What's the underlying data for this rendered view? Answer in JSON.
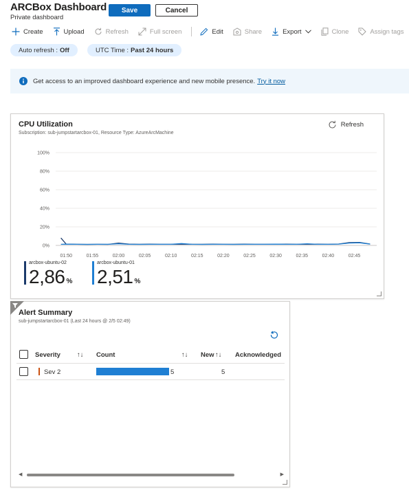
{
  "header": {
    "title": "ARCBox Dashboard",
    "subtitle": "Private dashboard"
  },
  "actions": {
    "save": "Save",
    "cancel": "Cancel"
  },
  "toolbar": {
    "create": "Create",
    "upload": "Upload",
    "refresh": "Refresh",
    "fullscreen": "Full screen",
    "edit": "Edit",
    "share": "Share",
    "export": "Export",
    "clone": "Clone",
    "assign_tags": "Assign tags"
  },
  "filters": {
    "auto_refresh_label": "Auto refresh :",
    "auto_refresh_value": "Off",
    "time_label": "UTC Time :",
    "time_value": "Past 24 hours"
  },
  "banner": {
    "text": "Get access to an improved dashboard experience and new mobile presence.",
    "link": "Try it now"
  },
  "cpu_tile": {
    "title": "CPU Utilization",
    "subtitle": "Subscription: sub-jumpstartarcbox-01, Resource Type: AzureArcMachine",
    "refresh": "Refresh",
    "kpis": [
      {
        "name": "arcbox-ubuntu-02",
        "value": "2,86",
        "unit": "%",
        "color": "#1b3a6b"
      },
      {
        "name": "arcbox-ubuntu-01",
        "value": "2,51",
        "unit": "%",
        "color": "#1f7fd3"
      }
    ]
  },
  "chart_data": {
    "type": "line",
    "title": "CPU Utilization",
    "y_ticks": [
      "100%",
      "80%",
      "60%",
      "40%",
      "20%",
      "0%"
    ],
    "ylim": [
      0,
      100
    ],
    "x_ticks": [
      "01:50",
      "01:55",
      "02:00",
      "02:05",
      "02:10",
      "02:15",
      "02:20",
      "02:25",
      "02:30",
      "02:35",
      "02:40",
      "02:45"
    ],
    "x": [
      "01:49",
      "01:50",
      "01:52",
      "01:54",
      "01:56",
      "01:58",
      "02:00",
      "02:02",
      "02:04",
      "02:06",
      "02:08",
      "02:10",
      "02:12",
      "02:14",
      "02:16",
      "02:18",
      "02:20",
      "02:22",
      "02:24",
      "02:26",
      "02:28",
      "02:30",
      "02:32",
      "02:34",
      "02:36",
      "02:38",
      "02:40",
      "02:42",
      "02:44",
      "02:46",
      "02:48"
    ],
    "series": [
      {
        "name": "arcbox-ubuntu-02",
        "color": "#1b3a6b",
        "values": [
          8,
          1.5,
          1.2,
          1.1,
          1.2,
          1.1,
          2.5,
          1.3,
          1.2,
          1.3,
          1.2,
          1.2,
          1.3,
          1.2,
          1.2,
          1.3,
          1.2,
          1.2,
          1.3,
          1.2,
          1.2,
          1.2,
          1.3,
          1.2,
          1.2,
          1.3,
          1.2,
          1.5,
          3.0,
          3.2,
          1.5
        ]
      },
      {
        "name": "arcbox-ubuntu-01",
        "color": "#1f7fd3",
        "values": [
          1.2,
          1.3,
          1.2,
          1.1,
          1.2,
          1.2,
          1.8,
          1.2,
          1.1,
          1.2,
          1.2,
          1.2,
          2.0,
          1.2,
          1.1,
          1.2,
          1.2,
          1.1,
          1.2,
          1.2,
          1.2,
          1.3,
          1.2,
          1.2,
          1.8,
          1.2,
          1.2,
          1.4,
          2.5,
          2.8,
          1.4
        ]
      }
    ]
  },
  "alert_tile": {
    "title": "Alert Summary",
    "subtitle": "sub-jumpstartarcbox-01 (Last 24 hours @ 2/5 02:49)",
    "columns": {
      "severity": "Severity",
      "count": "Count",
      "new": "New",
      "acknowledged": "Acknowledged"
    },
    "sort_glyph": "↑↓",
    "rows": [
      {
        "severity": "Sev 2",
        "count": "5",
        "new": "5",
        "count_fraction": 1.0
      }
    ]
  }
}
